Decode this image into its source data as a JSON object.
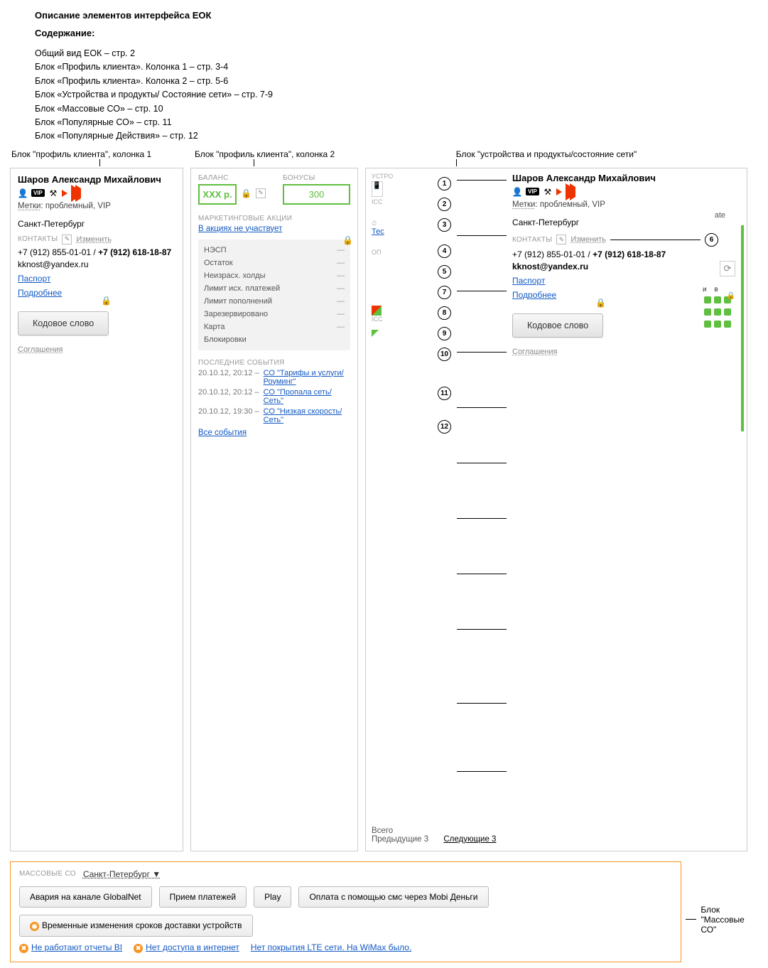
{
  "title": "Описание элементов интерфейса ЕОК",
  "contents_label": "Содержание:",
  "toc": [
    "Общий вид ЕОК – стр. 2",
    "Блок «Профиль клиента». Колонка 1 – стр. 3-4",
    "Блок «Профиль клиента». Колонка 2 – стр. 5-6",
    "Блок «Устройства и продукты/ Состояние сети» –  стр. 7-9",
    "Блок «Массовые СО» –  стр. 10",
    "Блок «Популярные СО» –  стр. 11",
    "Блок «Популярные Действия» –  стр. 12"
  ],
  "col_labels": {
    "c1": "Блок \"профиль клиента\", колонка 1",
    "c2": "Блок \"профиль клиента\", колонка 2",
    "c3": "Блок \"устройства и продукты/состояние сети\""
  },
  "profile": {
    "name": "Шаров Александр Михайлович",
    "vip": "VIP",
    "tags_label": "Метки",
    "tags_value": "проблемный, VIP",
    "city": "Санкт-Петербург",
    "contacts_label": "КОНТАКТЫ",
    "edit": "Изменить",
    "phone1": "+7 (912) 855-01-01 /",
    "phone2": "+7 (912) 618-18-87",
    "email": "kknost@yandex.ru",
    "passport": "Паспорт",
    "more": "Подробнее",
    "codeword": "Кодовое слово",
    "agreements": "Соглашения"
  },
  "balance": {
    "balance_label": "БАЛАНС",
    "balance_value": "XXX р.",
    "bonus_label": "БОНУСЫ",
    "bonus_value": "300",
    "marketing_label": "МАРКЕТИНГОВЫЕ АКЦИИ",
    "marketing_link": "В акциях не участвует",
    "rows": [
      "НЭСП",
      "Остаток",
      "Неизрасх. холды",
      "Лимит исх. платежей",
      "Лимит пополнений",
      "Зарезервировано",
      "Карта",
      "Блокировки"
    ],
    "events_label": "ПОСЛЕДНИЕ СОБЫТИЯ",
    "events": [
      {
        "d": "20.10.12, 20:12 –",
        "t": "СО \"Тарифы и услуги/ Роуминг\""
      },
      {
        "d": "20.10.12, 20:12 –",
        "t": "СО \"Пропала сеть/Сеть\""
      },
      {
        "d": "20.10.12, 19:30 –",
        "t": "СО \"Низкая скорость/Сеть\""
      }
    ],
    "all_events": "Все события"
  },
  "card3": {
    "left_label": "УСТРО",
    "icc": "ICC",
    "tech": "Тес",
    "opl": "ОП",
    "all": "Всего",
    "prev": "Предыдущие 3",
    "next": "Следующие 3",
    "ate": "ate",
    "iv": "и   в"
  },
  "mass": {
    "label": "МАССОВЫЕ СО",
    "city": "Санкт-Петербург",
    "buttons": [
      "Авария на канале GlobalNet",
      "Прием платежей",
      "Play",
      "Оплата с помощью смс через Mobi Деньги",
      "Временные изменения сроков доставки устройств"
    ],
    "links": [
      "Не работают отчеты BI",
      "Нет доступа в интернет",
      "Нет покрытия LTE сети. На WiMax было."
    ],
    "side_label1": "Блок",
    "side_label2": "\"Массовые СО\""
  }
}
